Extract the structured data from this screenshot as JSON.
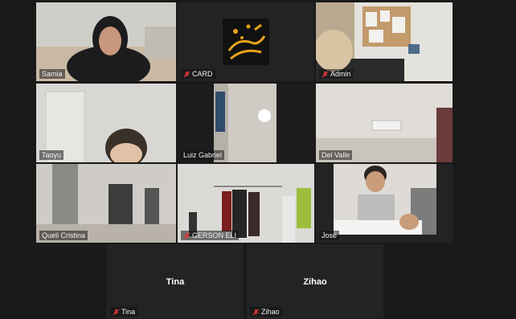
{
  "participants": [
    {
      "name": "Samia",
      "muted": false,
      "active": true
    },
    {
      "name": "CARD",
      "muted": true
    },
    {
      "name": "Admin",
      "muted": true
    },
    {
      "name": "Taoyu",
      "muted": false
    },
    {
      "name": "Luiz Gabriel",
      "muted": false
    },
    {
      "name": "Del Valle",
      "muted": false
    },
    {
      "name": "Queli Cristina",
      "muted": false
    },
    {
      "name": "GERSON ELI",
      "muted": true
    },
    {
      "name": "José",
      "muted": false
    },
    {
      "name": "Tina",
      "muted": true,
      "video_off": true
    },
    {
      "name": "Zihao",
      "muted": true,
      "video_off": true
    }
  ],
  "colors": {
    "active_border": "#c8e05a",
    "muted_icon": "#e03a3a",
    "card_logo_bg": "#1a1a1a",
    "card_logo_fg": "#e8a21a"
  }
}
